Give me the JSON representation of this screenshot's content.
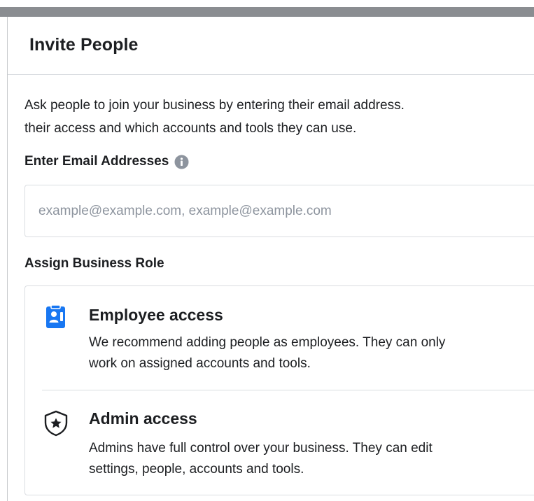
{
  "dialog": {
    "title": "Invite People",
    "intro_line1": "Ask people to join your business by entering their email address.",
    "intro_line2": "their access and which accounts and tools they can use."
  },
  "email": {
    "label": "Enter Email Addresses",
    "placeholder": "example@example.com, example@example.com",
    "value": ""
  },
  "role": {
    "label": "Assign Business Role",
    "options": [
      {
        "title": "Employee access",
        "desc_line1": "We recommend adding people as employees. They can only",
        "desc_line2": "work on assigned accounts and tools.",
        "icon": "employee-badge-icon"
      },
      {
        "title": "Admin access",
        "desc_line1": "Admins have full control over your business. They can edit",
        "desc_line2": "settings, people, accounts and tools.",
        "icon": "shield-star-icon"
      }
    ]
  },
  "colors": {
    "accent": "#1877f2",
    "text": "#1c1e21",
    "muted": "#8d949e",
    "border": "#dadde1"
  }
}
